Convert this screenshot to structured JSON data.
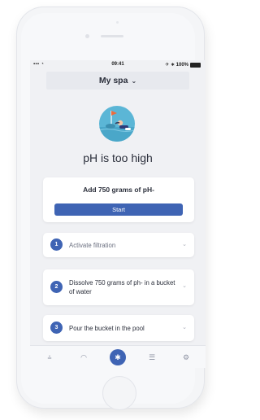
{
  "status_bar": {
    "signal": "▪▪▪ ◔",
    "time": "09:41",
    "right": "✈ ∗ 100%"
  },
  "header": {
    "title": "My spa",
    "chevron": "⌄"
  },
  "illustration": {
    "icon": "person-in-pool-illustration"
  },
  "alert": {
    "title": "pH is too high"
  },
  "action_card": {
    "title": "Add 750 grams of pH-",
    "button_label": "Start"
  },
  "steps": [
    {
      "number": "1",
      "text": "Activate filtration",
      "chevron": "⌄"
    },
    {
      "number": "2",
      "text": "Dissolve 750 grams of ph- in a bucket of water",
      "chevron": "⌄"
    },
    {
      "number": "3",
      "text": "Pour the bucket in the pool",
      "chevron": "⌄"
    }
  ],
  "tab_bar": {
    "items": [
      {
        "icon": "pool-ladder-icon",
        "glyph": "⩮"
      },
      {
        "icon": "gauge-icon",
        "glyph": "◠"
      },
      {
        "icon": "bluetooth-icon",
        "glyph": "✱",
        "active": true
      },
      {
        "icon": "list-icon",
        "glyph": "☰"
      },
      {
        "icon": "settings-icon",
        "glyph": "⚙"
      }
    ]
  },
  "colors": {
    "accent": "#3f64b4",
    "illustration_bg": "#5bb6d6",
    "screen_bg": "#f0f1f4"
  }
}
